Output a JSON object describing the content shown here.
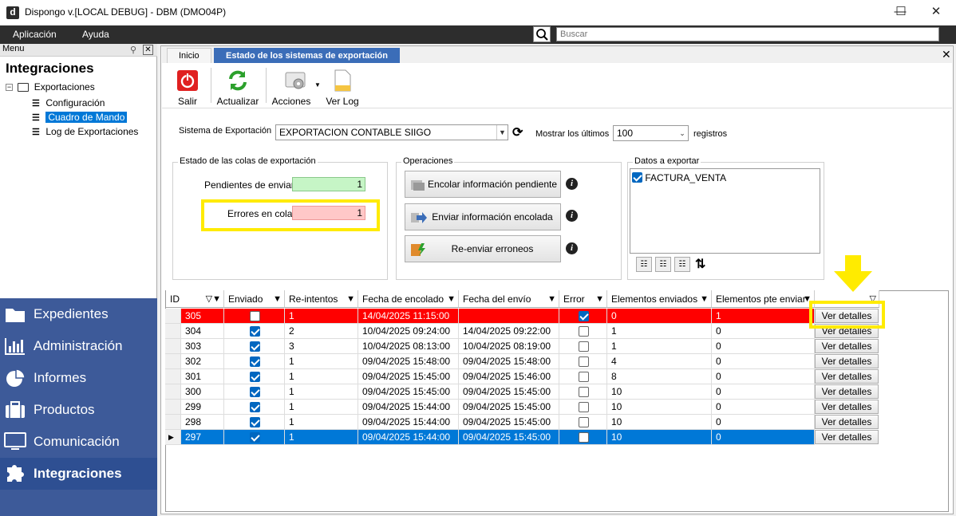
{
  "window": {
    "title": "Dispongo v.[LOCAL DEBUG] - DBM (DMO04P)",
    "app_icon": "d",
    "minimize": "—",
    "maximize": "☐",
    "close": "✕"
  },
  "menubar": {
    "items": [
      "Aplicación",
      "Ayuda"
    ],
    "search_placeholder": "Buscar"
  },
  "left": {
    "menu_label": "Menu",
    "title": "Integraciones",
    "tree": {
      "root": "Exportaciones",
      "children": [
        "Configuración",
        "Cuadro de Mando",
        "Log de Exportaciones"
      ],
      "selected": "Cuadro de Mando"
    },
    "nav": [
      "Expedientes",
      "Administración",
      "Informes",
      "Productos",
      "Comunicación",
      "Integraciones"
    ],
    "nav_active": "Integraciones"
  },
  "tabs": [
    {
      "label": "Inicio",
      "active": false
    },
    {
      "label": "Estado de los sistemas de exportación",
      "active": true
    }
  ],
  "toolbar": {
    "salir": "Salir",
    "actualizar": "Actualizar",
    "acciones": "Acciones",
    "verlog": "Ver Log"
  },
  "form": {
    "sistema_label": "Sistema de Exportación",
    "sistema_value": "EXPORTACION CONTABLE SIIGO",
    "mostrar_label": "Mostrar los últimos",
    "mostrar_value": "100",
    "registros_label": "registros"
  },
  "estado": {
    "title": "Estado de las colas de exportación",
    "pendientes_label": "Pendientes de enviar",
    "pendientes_value": "1",
    "errores_label": "Errores en cola",
    "errores_value": "1"
  },
  "operaciones": {
    "title": "Operaciones",
    "encolar": "Encolar información pendiente",
    "enviar": "Enviar información encolada",
    "reenviar": "Re-enviar erroneos",
    "info": "i"
  },
  "datos": {
    "title": "Datos a exportar",
    "items": [
      "FACTURA_VENTA"
    ],
    "sort_icon": "⇅"
  },
  "grid": {
    "headers": [
      "ID",
      "Enviado",
      "Re-intentos",
      "Fecha de encolado",
      "Fecha del envío",
      "Error",
      "Elementos enviados",
      "Elementos pte enviar"
    ],
    "button_label": "Ver detalles",
    "rows": [
      {
        "id": "305",
        "enviado": false,
        "reintentos": "1",
        "encolado": "14/04/2025 11:15:00",
        "envio": "",
        "error": true,
        "enviados": "0",
        "pte": "1",
        "state": "error"
      },
      {
        "id": "304",
        "enviado": true,
        "reintentos": "2",
        "encolado": "10/04/2025 09:24:00",
        "envio": "14/04/2025 09:22:00",
        "error": false,
        "enviados": "1",
        "pte": "0",
        "state": "normal"
      },
      {
        "id": "303",
        "enviado": true,
        "reintentos": "3",
        "encolado": "10/04/2025 08:13:00",
        "envio": "10/04/2025 08:19:00",
        "error": false,
        "enviados": "1",
        "pte": "0",
        "state": "normal"
      },
      {
        "id": "302",
        "enviado": true,
        "reintentos": "1",
        "encolado": "09/04/2025 15:48:00",
        "envio": "09/04/2025 15:48:00",
        "error": false,
        "enviados": "4",
        "pte": "0",
        "state": "normal"
      },
      {
        "id": "301",
        "enviado": true,
        "reintentos": "1",
        "encolado": "09/04/2025 15:45:00",
        "envio": "09/04/2025 15:46:00",
        "error": false,
        "enviados": "8",
        "pte": "0",
        "state": "normal"
      },
      {
        "id": "300",
        "enviado": true,
        "reintentos": "1",
        "encolado": "09/04/2025 15:45:00",
        "envio": "09/04/2025 15:45:00",
        "error": false,
        "enviados": "10",
        "pte": "0",
        "state": "normal"
      },
      {
        "id": "299",
        "enviado": true,
        "reintentos": "1",
        "encolado": "09/04/2025 15:44:00",
        "envio": "09/04/2025 15:45:00",
        "error": false,
        "enviados": "10",
        "pte": "0",
        "state": "normal"
      },
      {
        "id": "298",
        "enviado": true,
        "reintentos": "1",
        "encolado": "09/04/2025 15:44:00",
        "envio": "09/04/2025 15:45:00",
        "error": false,
        "enviados": "10",
        "pte": "0",
        "state": "normal"
      },
      {
        "id": "297",
        "enviado": true,
        "reintentos": "1",
        "encolado": "09/04/2025 15:44:00",
        "envio": "09/04/2025 15:45:00",
        "error": false,
        "enviados": "10",
        "pte": "0",
        "state": "selected"
      }
    ]
  },
  "colors": {
    "error_row": "#ff0000",
    "selected_row": "#0078d7",
    "accent": "#3b6db8",
    "nav_bg": "#3d5a99",
    "highlight": "#ffeb00",
    "pending_field": "#c6f5c6",
    "error_field": "#ffc8c8"
  }
}
